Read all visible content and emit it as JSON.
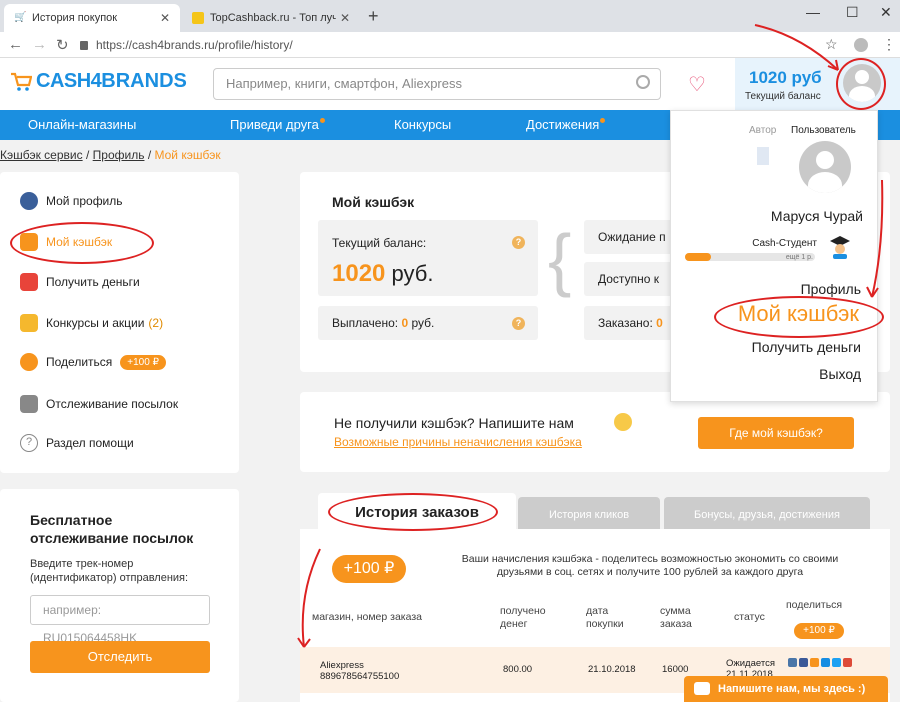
{
  "browser": {
    "tabs": [
      {
        "title": "История покупок",
        "active": true
      },
      {
        "title": "TopCashback.ru - Топ лучших к",
        "active": false
      }
    ],
    "url": "https://cash4brands.ru/profile/history/"
  },
  "header": {
    "logo_part1": "CASH4",
    "logo_part2": "BRANDS",
    "search_placeholder": "Например, книги, смартфон, Aliexpress",
    "balance_value": "1020 руб",
    "balance_label": "Текущий баланс"
  },
  "nav": {
    "items": [
      "Онлайн-магазины",
      "Приведи друга",
      "Конкурсы",
      "Достижения"
    ]
  },
  "breadcrumb": {
    "items": [
      "Кэшбэк сервис",
      "Профиль"
    ],
    "sep": "/",
    "current": "Мой кэшбэк"
  },
  "sidebar": {
    "items": [
      {
        "label": "Мой профиль"
      },
      {
        "label": "Мой кэшбэк"
      },
      {
        "label": "Получить деньги"
      },
      {
        "label": "Конкурсы и акции",
        "badge": "(2)"
      },
      {
        "label": "Поделиться",
        "badge": "+100 ₽"
      },
      {
        "label": "Отслеживание посылок"
      },
      {
        "label": "Раздел помощи"
      }
    ]
  },
  "tracking": {
    "title_line1": "Бесплатное",
    "title_line2": "отслеживание посылок",
    "hint_line1": "Введите трек-номер",
    "hint_line2": "(идентификатор) отправления:",
    "placeholder": "например: RU015064458HK",
    "button": "Отследить"
  },
  "cashback": {
    "title": "Мой кэшбэк",
    "current_label": "Текущий баланс:",
    "current_value": "1020",
    "current_unit": "руб.",
    "paid_label": "Выплачено:",
    "paid_value": "0",
    "paid_unit": "руб.",
    "pending_label": "Ожидание п",
    "available_label": "Доступно к",
    "ordered_label": "Заказано:",
    "ordered_value": "0"
  },
  "not_received": {
    "title": "Не получили кэшбэк? Напишите нам",
    "link": "Возможные причины неначисления кэшбэка",
    "button": "Где мой кэшбэк?"
  },
  "order_tabs": [
    "История заказов",
    "История кликов",
    "Бонусы, друзья, достижения"
  ],
  "orders": {
    "bonus_pill": "+100 ₽",
    "share_note": "Ваши начисления кэшбэка - поделитесь возможностью экономить со своими друзьями в соц. сетях и получите 100 рублей за каждого друга",
    "headers": {
      "store": "магазин, номер заказа",
      "received_1": "получено",
      "received_2": "денег",
      "date_1": "дата",
      "date_2": "покупки",
      "sum_1": "сумма",
      "sum_2": "заказа",
      "status": "статус",
      "share": "поделиться",
      "share_pill": "+100 ₽"
    },
    "rows": [
      {
        "store": "Aliexpress",
        "order_no": "889678564755100",
        "received": "800.00",
        "date": "21.10.2018",
        "sum": "16000",
        "status_1": "Ожидается",
        "status_2": "21.11.2018"
      }
    ]
  },
  "chat": {
    "label": "Напишите нам, мы здесь :)"
  },
  "dropdown": {
    "tab_author": "Автор",
    "tab_user": "Пользователь",
    "name": "Маруся Чурай",
    "status": "Cash-Студент",
    "progress_fraction": 0.2,
    "progress_hint": "ещё 1 р.",
    "links": [
      "Профиль",
      "Мой кэшбэк",
      "Получить деньги",
      "Выход"
    ]
  },
  "colors": {
    "brand_blue": "#1b8fe0",
    "accent_orange": "#f7941d",
    "annotation_red": "#dd2222"
  }
}
